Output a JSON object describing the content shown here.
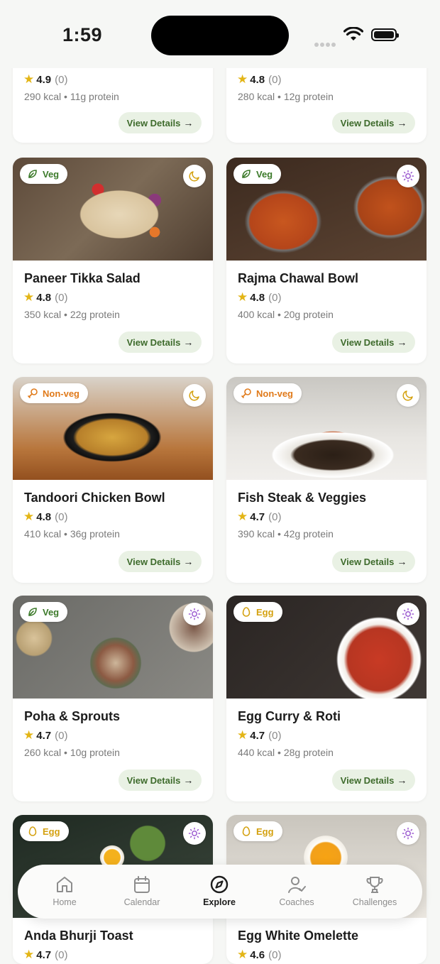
{
  "status": {
    "time": "1:59"
  },
  "top_cards": [
    {
      "rating": "4.9",
      "count": "(0)",
      "meta": "290 kcal • 11g protein",
      "button": "View Details"
    },
    {
      "rating": "4.8",
      "count": "(0)",
      "meta": "280 kcal • 12g protein",
      "button": "View Details"
    }
  ],
  "cards": [
    {
      "name": "Paneer Tikka Salad",
      "badge": "Veg",
      "badge_type": "veg",
      "meal_icon": "moon-icon",
      "rating": "4.8",
      "count": "(0)",
      "meta": "350 kcal • 22g protein",
      "button": "View Details"
    },
    {
      "name": "Rajma Chawal Bowl",
      "badge": "Veg",
      "badge_type": "veg",
      "meal_icon": "sun-icon",
      "rating": "4.8",
      "count": "(0)",
      "meta": "400 kcal • 20g protein",
      "button": "View Details"
    },
    {
      "name": "Tandoori Chicken Bowl",
      "badge": "Non-veg",
      "badge_type": "nonveg",
      "meal_icon": "moon-icon",
      "rating": "4.8",
      "count": "(0)",
      "meta": "410 kcal • 36g protein",
      "button": "View Details"
    },
    {
      "name": "Fish Steak & Veggies",
      "badge": "Non-veg",
      "badge_type": "nonveg",
      "meal_icon": "moon-icon",
      "rating": "4.7",
      "count": "(0)",
      "meta": "390 kcal • 42g protein",
      "button": "View Details"
    },
    {
      "name": "Poha & Sprouts",
      "badge": "Veg",
      "badge_type": "veg",
      "meal_icon": "sun-icon",
      "rating": "4.7",
      "count": "(0)",
      "meta": "260 kcal • 10g protein",
      "button": "View Details"
    },
    {
      "name": "Egg Curry & Roti",
      "badge": "Egg",
      "badge_type": "egg",
      "meal_icon": "sun-icon",
      "rating": "4.7",
      "count": "(0)",
      "meta": "440 kcal • 28g protein",
      "button": "View Details"
    },
    {
      "name": "Anda Bhurji Toast",
      "badge": "Egg",
      "badge_type": "egg",
      "meal_icon": "sun-icon",
      "rating": "4.7",
      "count": "(0)"
    },
    {
      "name": "Egg White Omelette",
      "badge": "Egg",
      "badge_type": "egg",
      "meal_icon": "sun-icon",
      "rating": "4.6",
      "count": "(0)"
    }
  ],
  "tabs": [
    {
      "label": "Home",
      "icon": "home-icon",
      "active": false
    },
    {
      "label": "Calendar",
      "icon": "calendar-icon",
      "active": false
    },
    {
      "label": "Explore",
      "icon": "compass-icon",
      "active": true
    },
    {
      "label": "Coaches",
      "icon": "coach-icon",
      "active": false
    },
    {
      "label": "Challenges",
      "icon": "trophy-icon",
      "active": false
    }
  ],
  "colors": {
    "accent_green": "#3e6b2c",
    "button_bg": "#e9f1e4",
    "star": "#e3b516",
    "nonveg": "#e07a1a",
    "egg": "#d4a10f",
    "sun_icon": "#9b59d0"
  }
}
